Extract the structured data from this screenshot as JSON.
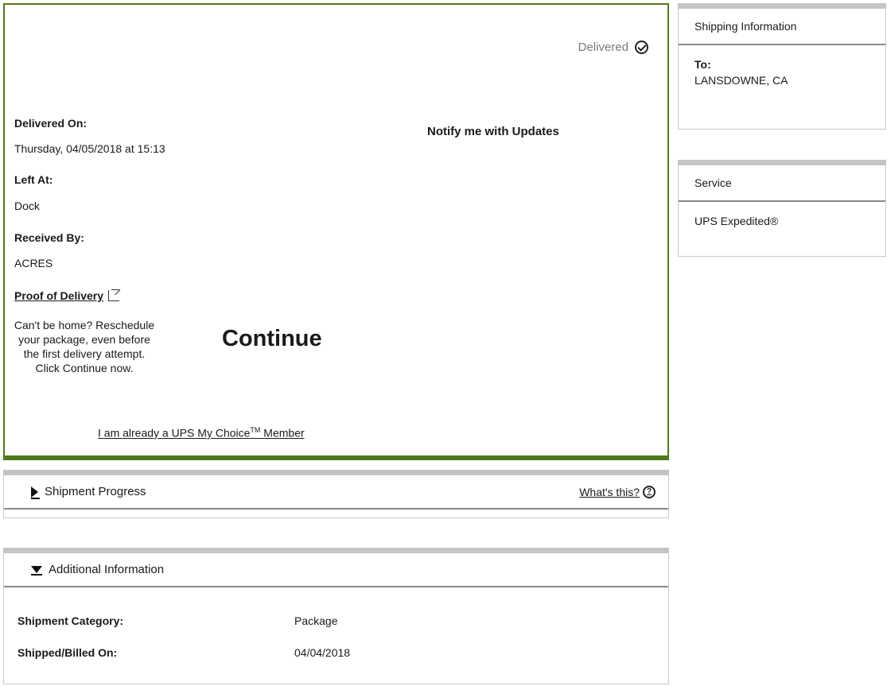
{
  "delivery": {
    "status": "Delivered",
    "delivered_on_label": "Delivered On:",
    "delivered_on_value": "Thursday,  04/05/2018 at 15:13",
    "left_at_label": "Left At:",
    "left_at_value": "Dock",
    "received_by_label": "Received By:",
    "received_by_value": "ACRES",
    "proof_link": "Proof of Delivery",
    "notify": "Notify me with Updates",
    "reschedule_text": "Can't be home? Reschedule your package, even before the first delivery attempt. Click Continue now.",
    "continue_label": "Continue",
    "member_link": "I am already a UPS My Choice",
    "member_tm": "TM",
    "member_link_suffix": " Member"
  },
  "shipping_info": {
    "title": "Shipping Information",
    "to_label": "To:",
    "to_value": "LANSDOWNE,  CA"
  },
  "service": {
    "title": "Service",
    "value": "UPS Expedited®"
  },
  "shipment_progress": {
    "title": "Shipment Progress",
    "help_link": "What's this?"
  },
  "additional_info": {
    "title": "Additional Information",
    "rows": [
      {
        "label": "Shipment Category:",
        "value": "Package"
      },
      {
        "label": "Shipped/Billed On:",
        "value": "04/04/2018"
      }
    ]
  }
}
